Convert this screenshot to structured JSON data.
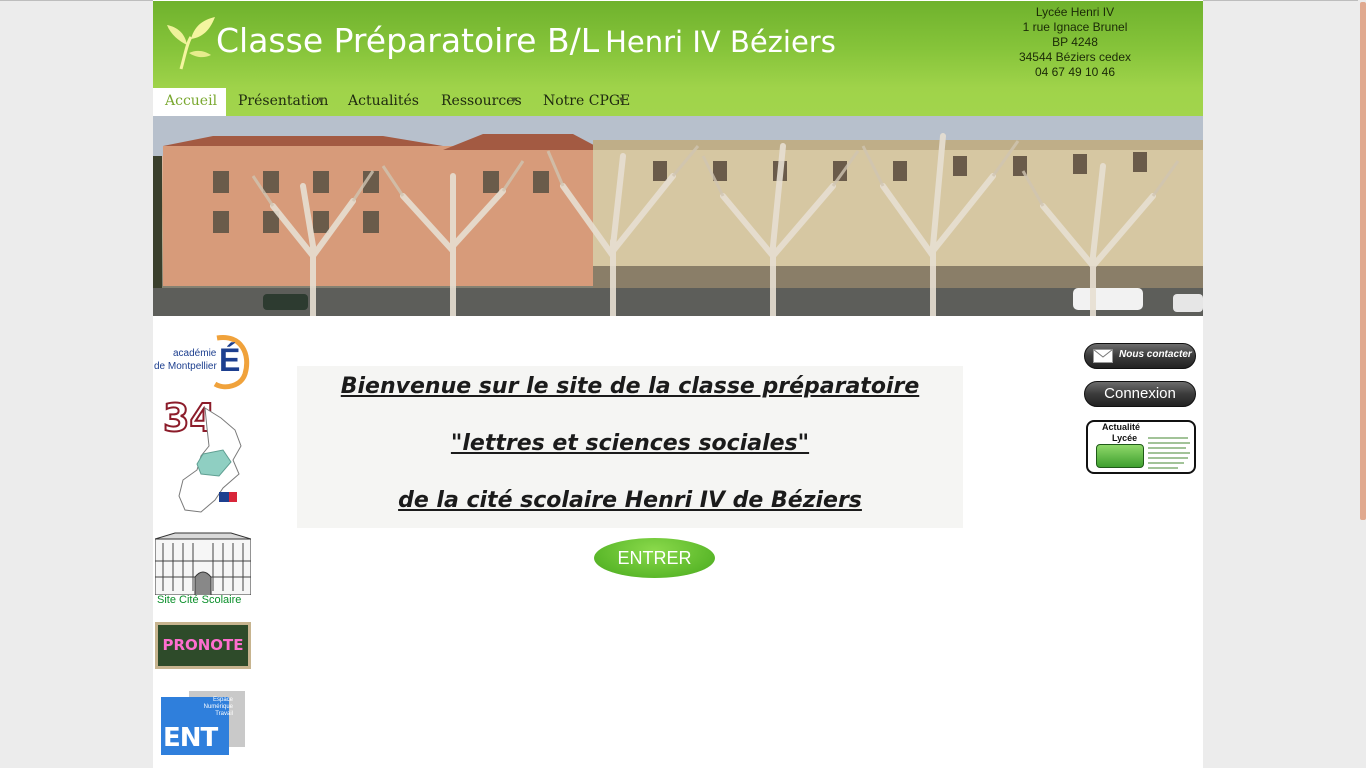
{
  "header": {
    "title_main": "Classe Préparatoire B/L",
    "title_sub": "Henri IV Béziers",
    "address": [
      "Lycée Henri IV",
      "1 rue Ignace Brunel",
      "BP 4248",
      "34544 Béziers cedex",
      "04 67 49 10 46"
    ]
  },
  "nav": {
    "items": [
      {
        "label": "Accueil",
        "active": true,
        "has_dropdown": false
      },
      {
        "label": "Présentation",
        "active": false,
        "has_dropdown": true
      },
      {
        "label": "Actualités",
        "active": false,
        "has_dropdown": false
      },
      {
        "label": "Ressources",
        "active": false,
        "has_dropdown": true
      },
      {
        "label": "Notre CPGE",
        "active": false,
        "has_dropdown": true
      }
    ]
  },
  "left_logos": {
    "academie_line1": "académie",
    "academie_line2": "de Montpellier",
    "academie_letter": "É",
    "departement_number": "34",
    "cite_label": "Site Cité Scolaire",
    "pronote": "PRONOTE",
    "ent_text": "Espace Numérique Travail",
    "ent_letters": "ENT"
  },
  "welcome": {
    "line1": "Bienvenue sur le site de la classe préparatoire",
    "line2": "\"lettres et sciences sociales\"",
    "line3": "de la cité scolaire Henri IV de Béziers"
  },
  "enter_button": "ENTRER",
  "right_col": {
    "contact_button": "Nous contacter",
    "login_button": "Connexion",
    "news_line1": "Actualité",
    "news_line2": "Lycée"
  },
  "colors": {
    "header_green": "#86c43a",
    "nav_green": "#a2d54c",
    "active_text": "#7aa830",
    "enter_green": "#5bb82a",
    "page_bg": "#ececec"
  }
}
